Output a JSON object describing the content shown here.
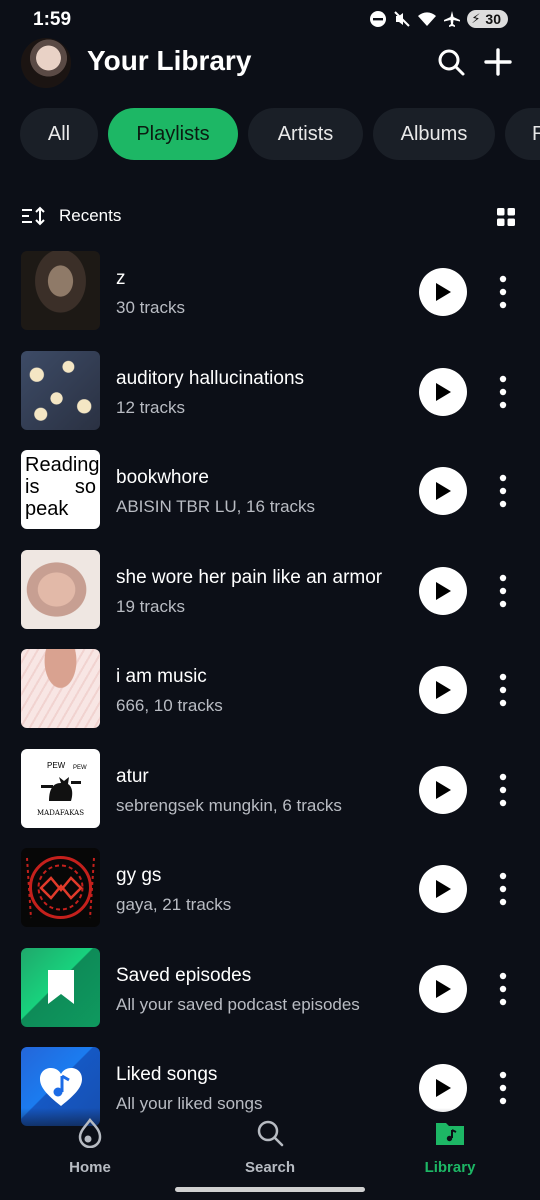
{
  "status": {
    "time": "1:59",
    "battery": "30"
  },
  "header": {
    "title": "Your Library"
  },
  "filters": [
    "All",
    "Playlists",
    "Artists",
    "Albums",
    "R"
  ],
  "sort": {
    "label": "Recents"
  },
  "playlists": [
    {
      "title": "z",
      "subtitle": "30 tracks"
    },
    {
      "title": "auditory hallucinations",
      "subtitle": "12 tracks"
    },
    {
      "title": "bookwhore",
      "subtitle": "ABISIN TBR LU, 16 tracks",
      "cover_text": [
        "Reading",
        "is",
        "so",
        "peak"
      ]
    },
    {
      "title": "she wore her pain like an armor",
      "subtitle": "19 tracks"
    },
    {
      "title": "i am music",
      "subtitle": "666, 10 tracks"
    },
    {
      "title": "atur",
      "subtitle": "sebrengsek mungkin, 6 tracks",
      "cover_text": [
        "PEW",
        "PEW",
        "MADAFAKAS"
      ]
    },
    {
      "title": "gy gs",
      "subtitle": "gaya, 21 tracks"
    },
    {
      "title": "Saved episodes",
      "subtitle": "All your saved podcast episodes"
    },
    {
      "title": "Liked songs",
      "subtitle": "All your liked songs"
    }
  ],
  "nav": {
    "home": "Home",
    "search": "Search",
    "library": "Library"
  },
  "colors": {
    "accent": "#1db765",
    "background": "#0c0f17",
    "chip": "#1a1f27"
  }
}
